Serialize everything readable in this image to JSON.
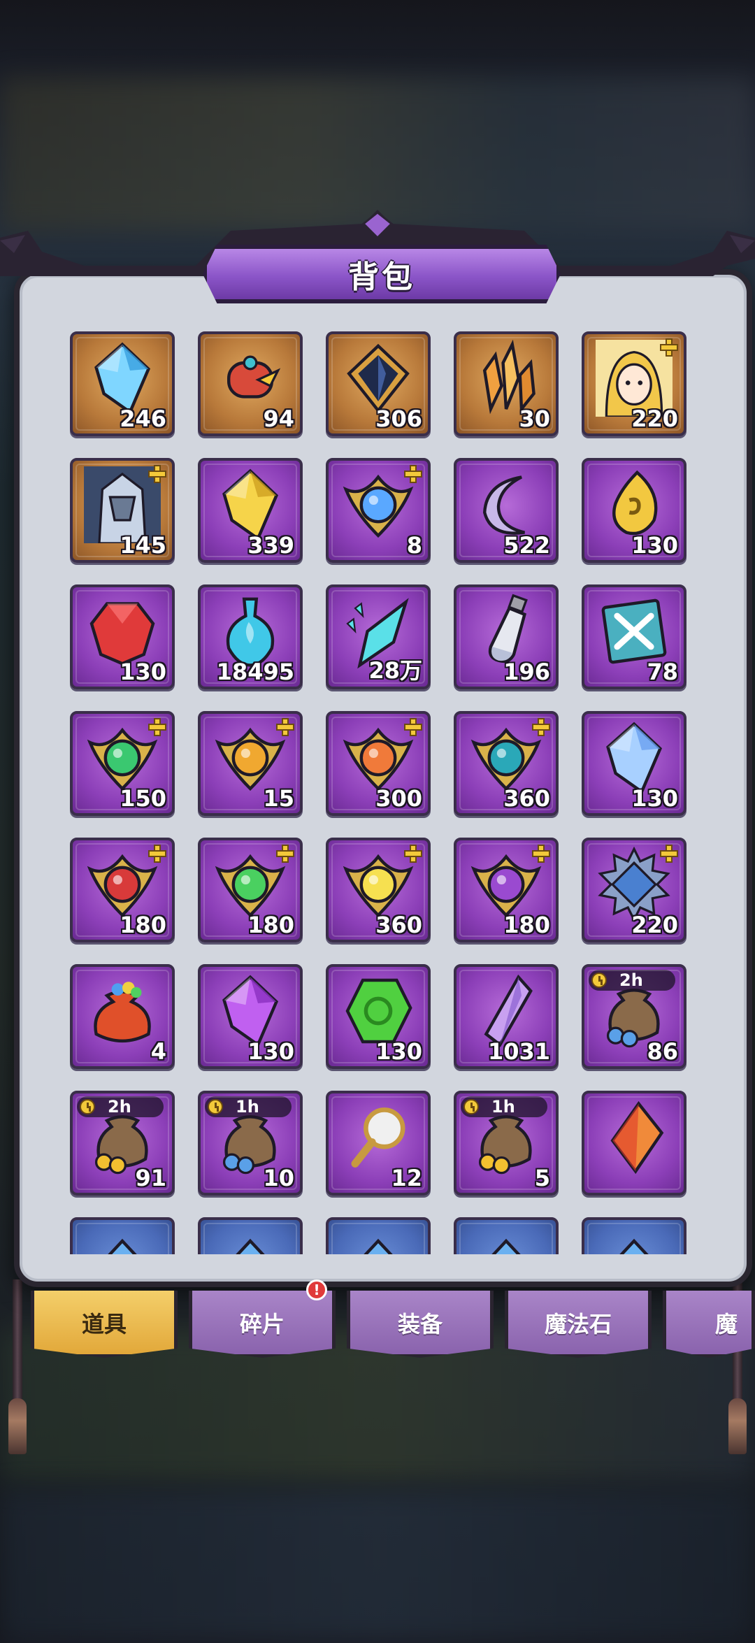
{
  "window": {
    "title": "背包"
  },
  "tabs": [
    {
      "label": "道具",
      "active": true
    },
    {
      "label": "碎片",
      "active": false
    },
    {
      "label": "装备",
      "active": false
    },
    {
      "label": "魔法石",
      "active": false
    },
    {
      "label": "魔",
      "active": false
    }
  ],
  "badge": {
    "text": "!"
  },
  "colors": {
    "accent": "#8b55c8",
    "active_tab": "#e2a83a",
    "panel": "#d2d6de"
  },
  "items": [
    {
      "icon": "blue-crystal-icon",
      "count": "246",
      "frame": "gold"
    },
    {
      "icon": "red-scroll-icon",
      "count": "94",
      "frame": "gold"
    },
    {
      "icon": "dark-gem-icon",
      "count": "306",
      "frame": "gold"
    },
    {
      "icon": "orange-crystal-cluster-icon",
      "count": "30",
      "frame": "gold"
    },
    {
      "icon": "hero-portrait-icon",
      "count": "220",
      "frame": "gold"
    },
    {
      "icon": "armored-hero-portrait-icon",
      "count": "145",
      "frame": "gold"
    },
    {
      "icon": "yellow-gem-icon",
      "count": "339",
      "frame": "purple"
    },
    {
      "icon": "blue-orb-emblem-icon",
      "count": "8",
      "frame": "purple"
    },
    {
      "icon": "crescent-moon-icon",
      "count": "522",
      "frame": "purple"
    },
    {
      "icon": "gold-rune-stone-icon",
      "count": "130",
      "frame": "purple"
    },
    {
      "icon": "red-ruby-icon",
      "count": "130",
      "frame": "purple"
    },
    {
      "icon": "blue-potion-icon",
      "count": "18495",
      "frame": "purple"
    },
    {
      "icon": "cyan-shard-icon",
      "count": "28万",
      "frame": "purple"
    },
    {
      "icon": "vial-icon",
      "count": "196",
      "frame": "purple"
    },
    {
      "icon": "sword-card-icon",
      "count": "78",
      "frame": "purple"
    },
    {
      "icon": "green-emblem-icon",
      "count": "150",
      "frame": "purple"
    },
    {
      "icon": "gold-emblem-icon",
      "count": "15",
      "frame": "purple"
    },
    {
      "icon": "orange-diamond-emblem-icon",
      "count": "300",
      "frame": "purple"
    },
    {
      "icon": "teal-drop-emblem-icon",
      "count": "360",
      "frame": "purple"
    },
    {
      "icon": "ice-crystal-icon",
      "count": "130",
      "frame": "purple"
    },
    {
      "icon": "red-swirl-emblem-icon",
      "count": "180",
      "frame": "purple"
    },
    {
      "icon": "green-wind-emblem-icon",
      "count": "180",
      "frame": "purple"
    },
    {
      "icon": "sun-emblem-icon",
      "count": "360",
      "frame": "purple"
    },
    {
      "icon": "purple-eye-emblem-icon",
      "count": "180",
      "frame": "purple"
    },
    {
      "icon": "spiked-diamond-emblem-icon",
      "count": "220",
      "frame": "purple"
    },
    {
      "icon": "treasure-sack-icon",
      "count": "4",
      "frame": "purple"
    },
    {
      "icon": "purple-shard-icon",
      "count": "130",
      "frame": "purple"
    },
    {
      "icon": "green-swirl-gem-icon",
      "count": "130",
      "frame": "purple"
    },
    {
      "icon": "amethyst-shard-icon",
      "count": "1031",
      "frame": "purple"
    },
    {
      "icon": "gem-bag-icon",
      "count": "86",
      "frame": "purple",
      "timer": "2h"
    },
    {
      "icon": "coin-bag-icon",
      "count": "91",
      "frame": "purple",
      "timer": "2h"
    },
    {
      "icon": "gem-bag-icon",
      "count": "10",
      "frame": "purple",
      "timer": "1h"
    },
    {
      "icon": "hand-mirror-icon",
      "count": "12",
      "frame": "purple"
    },
    {
      "icon": "coin-bag-icon",
      "count": "5",
      "frame": "purple",
      "timer": "1h"
    },
    {
      "icon": "orange-crystal-icon",
      "count": "",
      "frame": "purple"
    },
    {
      "icon": "blue-item-icon",
      "count": "",
      "frame": "blue"
    },
    {
      "icon": "blue-item-icon",
      "count": "",
      "frame": "blue"
    },
    {
      "icon": "blue-item-icon",
      "count": "",
      "frame": "blue"
    },
    {
      "icon": "blue-item-icon",
      "count": "",
      "frame": "blue"
    },
    {
      "icon": "blue-item-icon",
      "count": "",
      "frame": "blue"
    }
  ]
}
